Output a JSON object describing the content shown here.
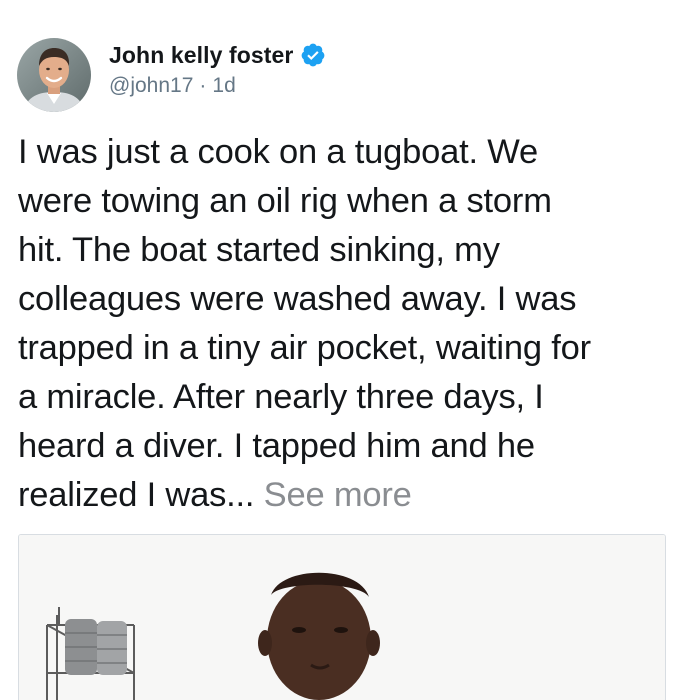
{
  "author": {
    "display_name": "John kelly foster",
    "handle": "@john17",
    "separator": "·",
    "time_ago": "1d",
    "verified": true,
    "avatar_icon": "avatar-photo",
    "verified_icon": "verified-badge-icon"
  },
  "tweet": {
    "text_lines": [
      "I was just a cook on a tugboat. We",
      "were towing an oil rig when a storm",
      "hit. The boat started sinking, my",
      "colleagues were washed away. I was",
      "trapped in a tiny air pocket, waiting for",
      "a miracle. After nearly three days, I",
      "heard a diver. I tapped him and he",
      "realized I was... "
    ],
    "see_more_label": "See more"
  },
  "colors": {
    "verified": "#1da1f2",
    "secondary_text": "#657786",
    "see_more": "#8a8d91",
    "media_border": "#d8dde2"
  }
}
